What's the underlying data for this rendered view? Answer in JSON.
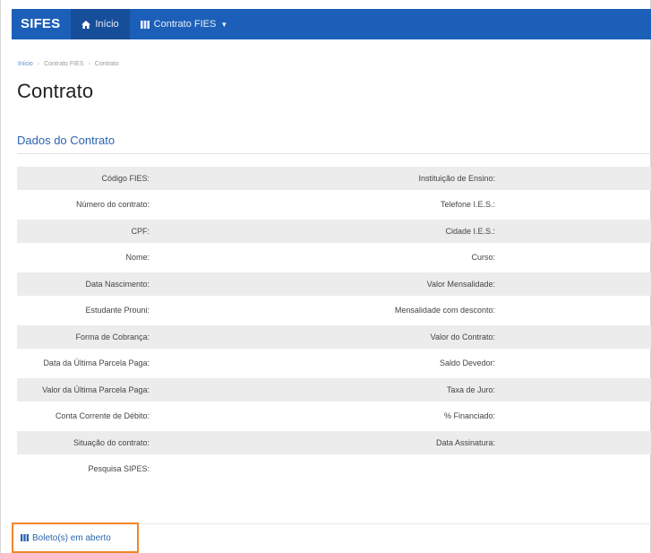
{
  "navbar": {
    "brand": "SIFES",
    "home_label": "Início",
    "menu_label": "Contrato FIES"
  },
  "breadcrumb": [
    "Início",
    "Contrato FIES",
    "Contrato"
  ],
  "page_title": "Contrato",
  "section_title": "Dados do Contrato",
  "fields": [
    {
      "left": "Código FIES:",
      "right": "Instituição de Ensino:",
      "shaded": true
    },
    {
      "left": "Número do contrato:",
      "right": "Telefone I.E.S.:",
      "shaded": false
    },
    {
      "left": "CPF:",
      "right": "Cidade I.E.S.:",
      "shaded": true
    },
    {
      "left": "Nome:",
      "right": "Curso:",
      "shaded": false
    },
    {
      "left": "Data Nascimento:",
      "right": "Valor Mensalidade:",
      "shaded": true
    },
    {
      "left": "Estudante Prouni:",
      "right": "Mensalidade com desconto:",
      "shaded": false
    },
    {
      "left": "Forma de Cobrança:",
      "right": "Valor do Contrato:",
      "shaded": true
    },
    {
      "left": "Data da Última Parcela Paga:",
      "right": "Saldo Devedor:",
      "shaded": false
    },
    {
      "left": "Valor da Última Parcela Paga:",
      "right": "Taxa de Juro:",
      "shaded": true
    },
    {
      "left": "Conta Corrente de Débito:",
      "right": "% Financiado:",
      "shaded": false
    },
    {
      "left": "Situação do contrato:",
      "right": "Data Assinatura:",
      "shaded": true
    },
    {
      "left": "Pesquisa SIPES:",
      "right": "",
      "shaded": false
    }
  ],
  "boleto_link": "Boleto(s) em aberto",
  "colors": {
    "navbar": "#1c5fb8",
    "link": "#2b64b0",
    "highlight": "#f0862a",
    "row_shade": "#ececec"
  },
  "icons": {
    "home": "home-icon",
    "menu": "table-icon",
    "boleto": "table-icon"
  }
}
